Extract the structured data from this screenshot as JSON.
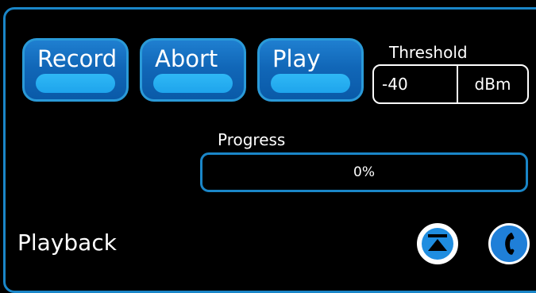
{
  "buttons": {
    "record_label": "Record",
    "abort_label": "Abort",
    "play_label": "Play"
  },
  "threshold": {
    "label": "Threshold",
    "value": "-40",
    "unit": "dBm"
  },
  "progress": {
    "label": "Progress",
    "value_text": "0%",
    "fraction": 0
  },
  "footer": {
    "title": "Playback",
    "icons": [
      "eject-icon",
      "phone-icon"
    ]
  },
  "colors": {
    "accent": "#1a86c8",
    "button_fill": "#1167b8",
    "button_highlight": "#1ea4ec",
    "background": "#000000",
    "text": "#ffffff"
  }
}
